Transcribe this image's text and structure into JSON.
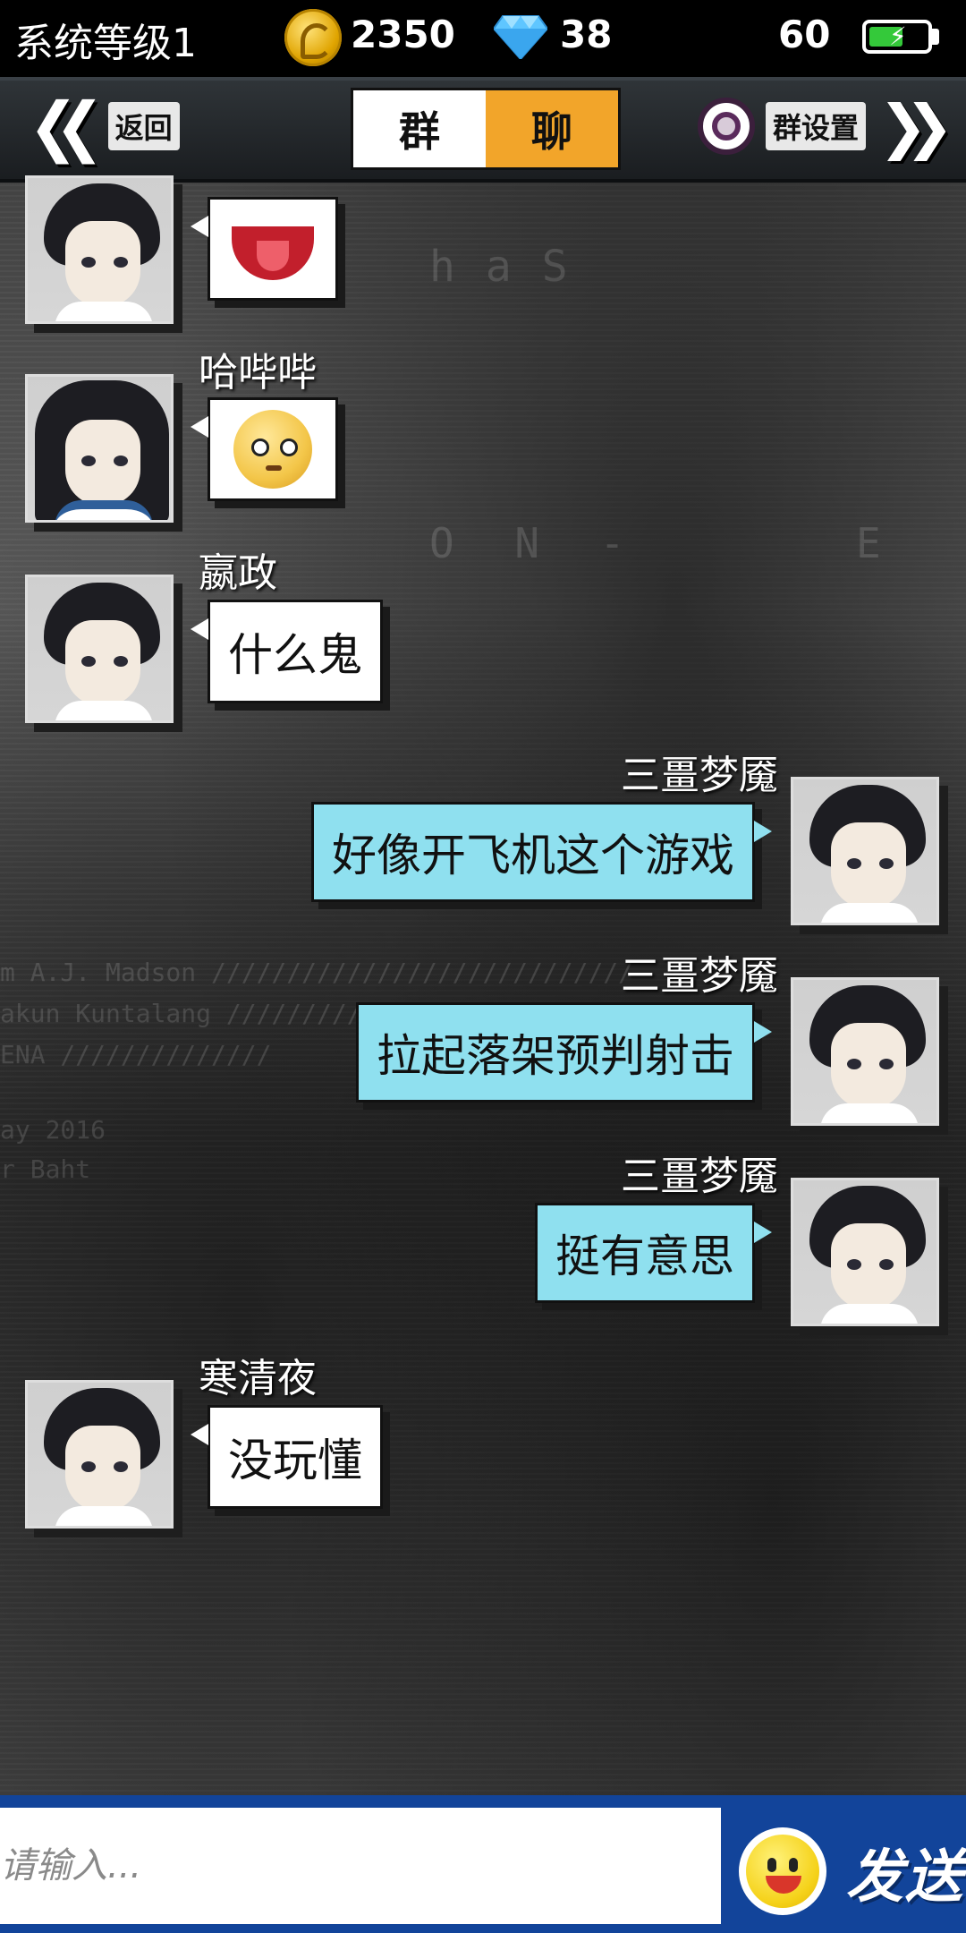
{
  "status": {
    "level": "系统等级1",
    "coins": "2350",
    "gems": "38",
    "battery": "60",
    "battery_level": 0.6
  },
  "header": {
    "back_label": "返回",
    "tab_left": "群",
    "tab_right": "聊",
    "settings_label": "群设置"
  },
  "background_text": {
    "t1": "haS",
    "t2": "O N -     E",
    "t3": "m A.J. Madson ////////////////////////////",
    "t4": "akun Kuntalang //////////",
    "t5": "ENA //////////////",
    "t6": "ay 2016",
    "t7": "r Baht",
    "t8": "O N E"
  },
  "messages": [
    {
      "name": "",
      "type": "emoji",
      "emoji": "tongue-mouth-emoji",
      "side": "left"
    },
    {
      "name": "哈哔哔",
      "type": "emoji",
      "emoji": "eye-roll-emoji",
      "side": "left"
    },
    {
      "name": "嬴政",
      "type": "text",
      "text": "什么鬼",
      "side": "left"
    },
    {
      "name": "三畺梦魇",
      "type": "text",
      "text": "好像开飞机这个游戏",
      "side": "right"
    },
    {
      "name": "三畺梦魇",
      "type": "text",
      "text": "拉起落架预判射击",
      "side": "right"
    },
    {
      "name": "三畺梦魇",
      "type": "text",
      "text": "挺有意思",
      "side": "right"
    },
    {
      "name": "寒清夜",
      "type": "text",
      "text": "没玩懂",
      "side": "left"
    }
  ],
  "input": {
    "placeholder": "请输入..."
  },
  "send_label": "发送",
  "colors": {
    "accent_orange": "#f2a52a",
    "bubble_blue": "#8fe0ef",
    "input_bar": "#12449a"
  }
}
